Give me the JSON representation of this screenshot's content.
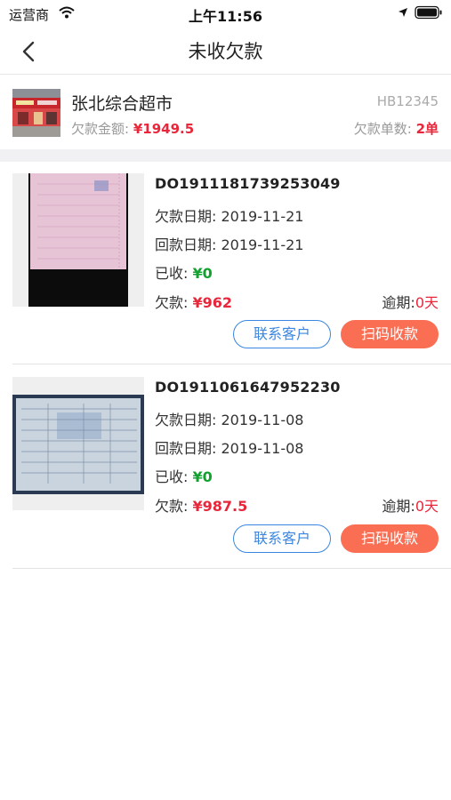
{
  "status_bar": {
    "carrier": "运营商",
    "time": "上午11:56",
    "icons": [
      "wifi-icon",
      "location-arrow-icon",
      "battery-icon"
    ]
  },
  "nav": {
    "title": "未收欠款",
    "back_icon": "chevron-left-icon"
  },
  "store": {
    "name": "张北综合超市",
    "code": "HB12345",
    "debt_amount_label": "欠款金额:",
    "debt_amount_value": "¥1949.5",
    "debt_count_label": "欠款单数:",
    "debt_count_value": "2单"
  },
  "orders": [
    {
      "order_no": "DO1911181739253049",
      "debt_date_label": "欠款日期:",
      "debt_date": "2019-11-21",
      "repay_date_label": "回款日期:",
      "repay_date": "2019-11-21",
      "received_label": "已收:",
      "received_value": "¥0",
      "debt_label": "欠款:",
      "debt_value": "¥962",
      "overdue_label": "逾期:",
      "overdue_value": "0天",
      "contact_label": "联系客户",
      "collect_label": "扫码收款"
    },
    {
      "order_no": "DO1911061647952230",
      "debt_date_label": "欠款日期:",
      "debt_date": "2019-11-08",
      "repay_date_label": "回款日期:",
      "repay_date": "2019-11-08",
      "received_label": "已收:",
      "received_value": "¥0",
      "debt_label": "欠款:",
      "debt_value": "¥987.5",
      "overdue_label": "逾期:",
      "overdue_value": "0天",
      "contact_label": "联系客户",
      "collect_label": "扫码收款"
    }
  ],
  "colors": {
    "accent_red": "#e8273b",
    "received_green": "#12a12f",
    "contact_blue": "#3b86e0",
    "collect_orange": "#fa6f54"
  }
}
